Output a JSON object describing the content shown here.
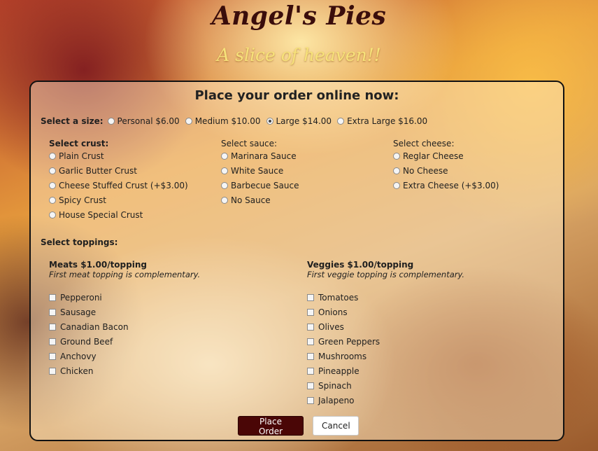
{
  "brand": {
    "title": "Angel's Pies",
    "tagline": "A slice of heaven!!"
  },
  "heading": "Place your order online now:",
  "size": {
    "label": "Select a size:",
    "options": [
      "Personal $6.00",
      "Medium $10.00",
      "Large $14.00",
      "Extra Large $16.00"
    ],
    "selected": "Large $14.00"
  },
  "crust": {
    "label": "Select crust:",
    "options": [
      "Plain Crust",
      "Garlic Butter Crust",
      "Cheese Stuffed Crust (+$3.00)",
      "Spicy Crust",
      "House Special Crust"
    ]
  },
  "sauce": {
    "label": "Select sauce:",
    "options": [
      "Marinara Sauce",
      "White Sauce",
      "Barbecue Sauce",
      "No Sauce"
    ]
  },
  "cheese": {
    "label": "Select cheese:",
    "options": [
      "Reglar Cheese",
      "No Cheese",
      "Extra Cheese (+$3.00)"
    ]
  },
  "toppings": {
    "label": "Select toppings:",
    "meats": {
      "header": "Meats $1.00/topping",
      "note": "First meat topping is complementary.",
      "items": [
        "Pepperoni",
        "Sausage",
        "Canadian Bacon",
        "Ground Beef",
        "Anchovy",
        "Chicken"
      ]
    },
    "veggies": {
      "header": "Veggies $1.00/topping",
      "note": "First veggie topping is complementary.",
      "items": [
        "Tomatoes",
        "Onions",
        "Olives",
        "Green Peppers",
        "Mushrooms",
        "Pineapple",
        "Spinach",
        "Jalapeno"
      ]
    }
  },
  "actions": {
    "order_label": "Place Order",
    "cancel_label": "Cancel"
  },
  "colors": {
    "brand_dark": "#3a0d0b",
    "tagline": "#f7e27a",
    "order_button": "#4a0606"
  }
}
